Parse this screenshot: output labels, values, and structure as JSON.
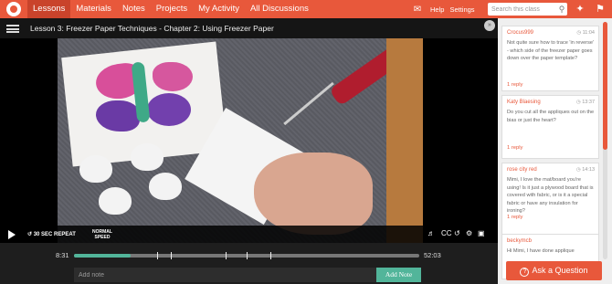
{
  "colors": {
    "brand": "#e8583b",
    "accent": "#52b59a",
    "dark": "#1e1e1e"
  },
  "nav": {
    "items": [
      {
        "label": "Lessons",
        "active": true
      },
      {
        "label": "Materials"
      },
      {
        "label": "Notes"
      },
      {
        "label": "Projects"
      },
      {
        "label": "My Activity"
      },
      {
        "label": "All Discussions"
      }
    ],
    "help_label": "Help",
    "settings_label": "Settings",
    "search_placeholder": "Search this class"
  },
  "lesson": {
    "title": "Lesson 3: Freezer Paper Techniques - Chapter 2: Using Freezer Paper"
  },
  "player": {
    "repeat_label": "30 SEC REPEAT",
    "speed_line1": "NORMAL",
    "speed_line2": "SPEED",
    "cc_label": "CC",
    "current_time": "8:31",
    "total_time": "52:03",
    "progress": 0.165,
    "chapter_markers": [
      0.24,
      0.28,
      0.44,
      0.5,
      0.57
    ]
  },
  "notes": {
    "placeholder": "Add note",
    "add_label": "Add Note"
  },
  "discussion": {
    "posts": [
      {
        "user": "Crocus999",
        "time": "11:04",
        "text": "Not quite sure how to trace 'in reverse' - which side of the freezer paper goes down over the paper template?",
        "reply": "1 reply"
      },
      {
        "user": "Katy Blaesing",
        "time": "13:37",
        "text": "Do you cut all the appliques out on the bias or just the heart?",
        "reply": "1 reply"
      },
      {
        "user": "rose city red",
        "time": "14:13",
        "text": "Mimi, I love the mat/board you're using! Is it just a plywood board that is covered with fabric, or is it a special fabric or have any insulation for ironing?",
        "reply": "1 reply"
      },
      {
        "user": "beckymcb",
        "time": "",
        "text": "Hi Mimi, I have done applique",
        "reply": ""
      }
    ],
    "ask_label": "Ask a Question"
  }
}
